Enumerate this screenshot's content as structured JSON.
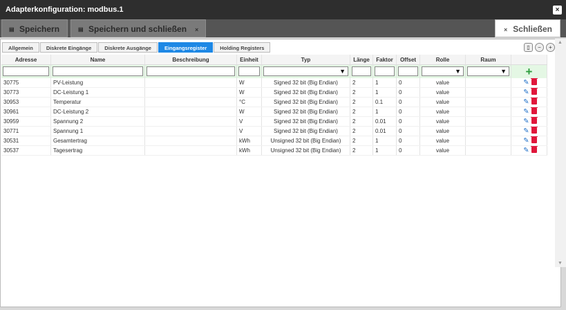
{
  "window": {
    "title": "Adapterkonfiguration: modbus.1"
  },
  "toolbar": {
    "save_label": "Speichern",
    "save_close_label": "Speichern und schließen",
    "close_label": "Schließen",
    "x_glyph": "×"
  },
  "tabs": [
    {
      "label": "Allgemein"
    },
    {
      "label": "Diskrete Eingänge"
    },
    {
      "label": "Diskrete Ausgänge"
    },
    {
      "label": "Eingangsregister"
    },
    {
      "label": "Holding Registers"
    }
  ],
  "active_tab": 3,
  "table": {
    "columns": [
      "Adresse",
      "Name",
      "Beschreibung",
      "Einheit",
      "Typ",
      "Länge",
      "Faktor",
      "Offset",
      "Rolle",
      "Raum"
    ],
    "rows": [
      {
        "address": "30775",
        "name": "PV-Leistung",
        "description": "",
        "unit": "W",
        "type": "Signed 32 bit (Big Endian)",
        "length": "2",
        "factor": "1",
        "offset": "0",
        "role": "value",
        "room": ""
      },
      {
        "address": "30773",
        "name": "DC-Leistung 1",
        "description": "",
        "unit": "W",
        "type": "Signed 32 bit (Big Endian)",
        "length": "2",
        "factor": "1",
        "offset": "0",
        "role": "value",
        "room": ""
      },
      {
        "address": "30953",
        "name": "Temperatur",
        "description": "",
        "unit": "°C",
        "type": "Signed 32 bit (Big Endian)",
        "length": "2",
        "factor": "0.1",
        "offset": "0",
        "role": "value",
        "room": ""
      },
      {
        "address": "30961",
        "name": "DC-Leistung 2",
        "description": "",
        "unit": "W",
        "type": "Signed 32 bit (Big Endian)",
        "length": "2",
        "factor": "1",
        "offset": "0",
        "role": "value",
        "room": ""
      },
      {
        "address": "30959",
        "name": "Spannung 2",
        "description": "",
        "unit": "V",
        "type": "Signed 32 bit (Big Endian)",
        "length": "2",
        "factor": "0.01",
        "offset": "0",
        "role": "value",
        "room": ""
      },
      {
        "address": "30771",
        "name": "Spannung 1",
        "description": "",
        "unit": "V",
        "type": "Signed 32 bit (Big Endian)",
        "length": "2",
        "factor": "0.01",
        "offset": "0",
        "role": "value",
        "room": ""
      },
      {
        "address": "30531",
        "name": "Gesamtertrag",
        "description": "",
        "unit": "kWh",
        "type": "Unsigned 32 bit (Big Endian)",
        "length": "2",
        "factor": "1",
        "offset": "0",
        "role": "value",
        "room": ""
      },
      {
        "address": "30537",
        "name": "Tagesertrag",
        "description": "",
        "unit": "kWh",
        "type": "Unsigned 32 bit (Big Endian)",
        "length": "2",
        "factor": "1",
        "offset": "0",
        "role": "value",
        "room": ""
      }
    ]
  },
  "colors": {
    "active_tab": "#1e88e5",
    "add": "#2e9e3e",
    "delete": "#e0173b",
    "edit": "#1e6fc8"
  }
}
